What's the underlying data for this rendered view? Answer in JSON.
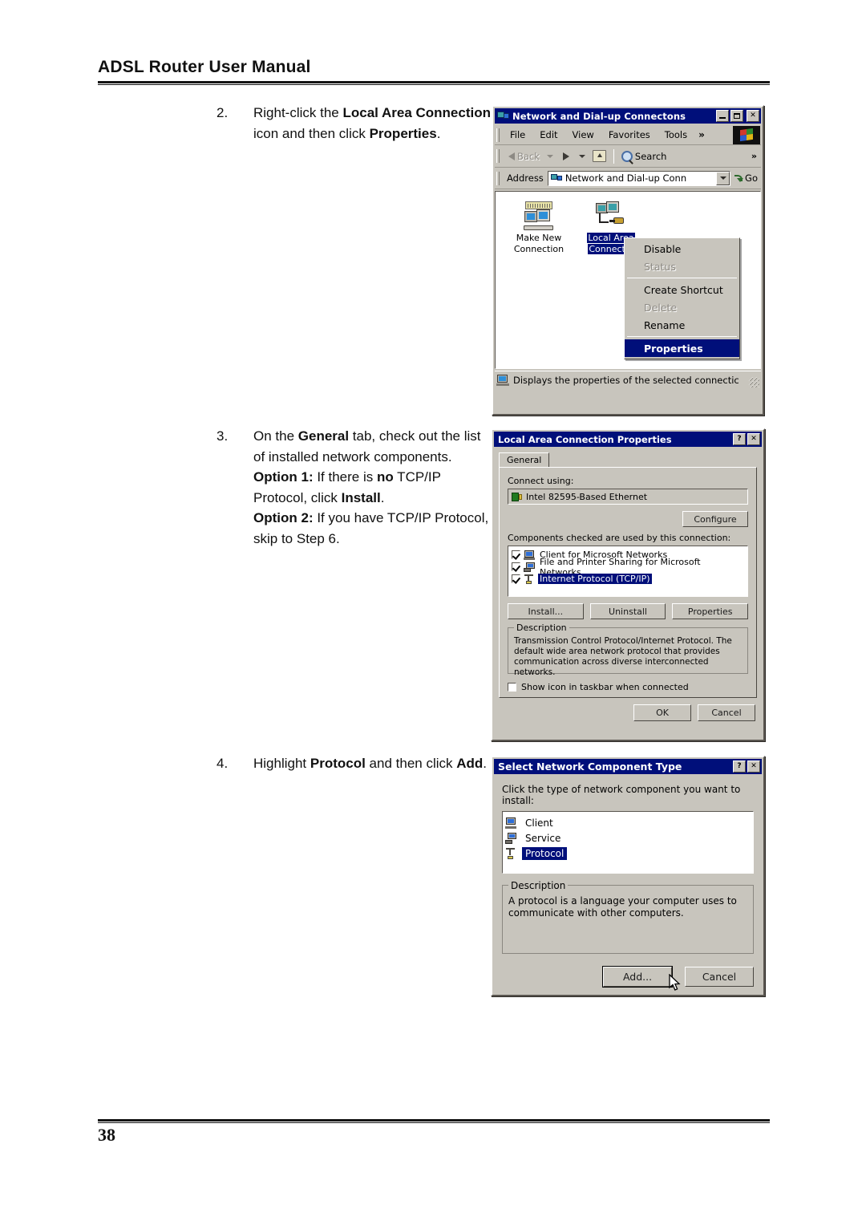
{
  "page": {
    "header_title": "ADSL Router User Manual",
    "page_number": "38"
  },
  "steps": [
    {
      "number": "2.",
      "html": "Right-click the <b>Local Area Connection</b> icon and then click <b>Properties</b>."
    },
    {
      "number": "3.",
      "html": "On the <b>General</b> tab, check out the list of installed network components.<br><b>Option 1:</b> If there is <b>no</b> TCP/IP Protocol, click <b>Install</b>.<br><b>Option 2:</b> If you have TCP/IP Protocol, skip to Step 6."
    },
    {
      "number": "4.",
      "html": "Highlight <b>Protocol</b> and then click <b>Add</b>."
    }
  ],
  "network_window": {
    "title": "Network and Dial-up Connectons",
    "title_icon": "network-connections-icon",
    "min_label": "_",
    "max_label": "□",
    "close_label": "✕",
    "menu": [
      "File",
      "Edit",
      "View",
      "Favorites",
      "Tools"
    ],
    "menu_overflow": "»",
    "toolbar": {
      "back_label": "Back",
      "forward_label": "",
      "up_label": "",
      "search_label": "Search",
      "overflow": "»"
    },
    "address": {
      "label": "Address",
      "value": "Network and Dial-up Conn",
      "go_label": "Go"
    },
    "icons": [
      {
        "label_line1": "Make New",
        "label_line2": "Connection",
        "selected": false
      },
      {
        "label_line1": "Local Area",
        "label_line2": "Connectio",
        "selected": true
      }
    ],
    "context_menu": [
      {
        "label": "Disable",
        "state": "normal"
      },
      {
        "label": "Status",
        "state": "disabled"
      },
      {
        "separator": true
      },
      {
        "label": "Create Shortcut",
        "state": "normal"
      },
      {
        "label": "Delete",
        "state": "disabled"
      },
      {
        "label": "Rename",
        "state": "normal"
      },
      {
        "separator": true
      },
      {
        "label": "Properties",
        "state": "highlighted"
      }
    ],
    "statusbar": "Displays the properties of the selected connectic"
  },
  "lac_properties": {
    "title": "Local Area Connection Properties",
    "help_label": "?",
    "close_label": "✕",
    "tab": "General",
    "connect_using_label": "Connect using:",
    "adapter": "Intel 82595-Based Ethernet",
    "configure_label": "Configure",
    "components_label": "Components checked are used by this connection:",
    "components": [
      {
        "label": "Client for Microsoft Networks",
        "checked": true,
        "selected": false,
        "icon": "client-icon"
      },
      {
        "label": "File and Printer Sharing for Microsoft Networks",
        "checked": true,
        "selected": false,
        "icon": "file-sharing-icon"
      },
      {
        "label": "Internet Protocol (TCP/IP)",
        "checked": true,
        "selected": true,
        "icon": "protocol-icon"
      }
    ],
    "buttons": {
      "install": "Install...",
      "uninstall": "Uninstall",
      "properties": "Properties"
    },
    "description_label": "Description",
    "description": "Transmission Control Protocol/Internet Protocol. The default wide area network protocol that provides communication across diverse interconnected networks.",
    "show_icon_label": "Show icon in taskbar when connected",
    "show_icon_checked": false,
    "ok_label": "OK",
    "cancel_label": "Cancel"
  },
  "component_type": {
    "title": "Select Network Component Type",
    "help_label": "?",
    "close_label": "✕",
    "prompt": "Click the type of network component you want to install:",
    "items": [
      {
        "label": "Client",
        "selected": false,
        "icon": "client-icon"
      },
      {
        "label": "Service",
        "selected": false,
        "icon": "service-icon"
      },
      {
        "label": "Protocol",
        "selected": true,
        "icon": "protocol-icon"
      }
    ],
    "description_label": "Description",
    "description": "A protocol is a language your computer uses to communicate with other computers.",
    "add_label": "Add...",
    "cancel_label": "Cancel"
  },
  "colors": {
    "titlebar": "#000f7a",
    "dialog_face": "#c8c5bd",
    "selection": "#000f7a",
    "text": "#000000"
  }
}
